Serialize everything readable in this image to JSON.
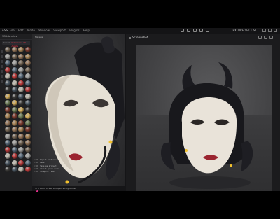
{
  "app": {
    "title": "Substance 3D Painter",
    "topbar_label": "ASS...",
    "menu": [
      "File",
      "Edit",
      "Mode",
      "Window",
      "Viewport",
      "Plugins",
      "Help"
    ],
    "texture_set_label": "TEXTURE SET LIST"
  },
  "library": {
    "header": "3D Libraries",
    "search_placeholder": "Search",
    "filter_badge": "Substance 3D Assets"
  },
  "viewport": {
    "tag": "Material",
    "screenshot_panel_title": "Screenshot"
  },
  "log": [
    {
      "time": "4:40",
      "text": "Export Textures"
    },
    {
      "time": "4:40",
      "text": "Bake"
    },
    {
      "time": "4:40",
      "text": "Save as project"
    },
    {
      "time": "4:40",
      "text": "Invert quick mask"
    },
    {
      "time": "4:40",
      "text": "Viewport reset"
    }
  ],
  "status_text": "4TH LAST: Draw: Dropped straight lines",
  "colors": {
    "accent": "#e0308a",
    "mask_white": "#e9e3d9",
    "hair_black": "#17171b",
    "lip_red": "#9b2530",
    "gem_yellow": "#f2c12e"
  }
}
